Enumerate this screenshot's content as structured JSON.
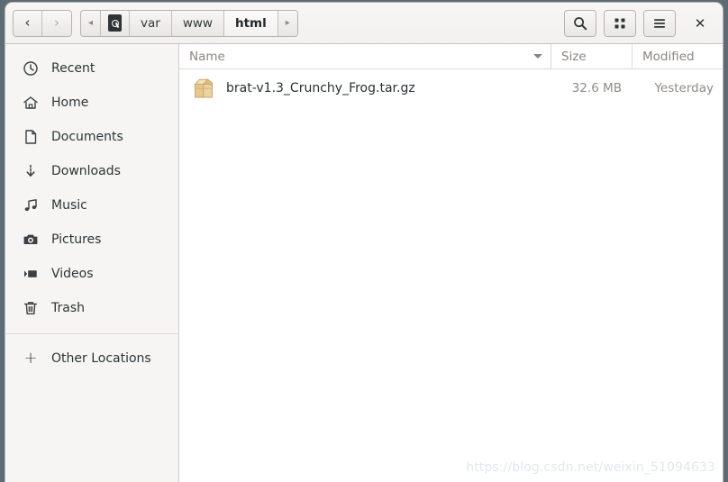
{
  "window": {
    "title": "html"
  },
  "header": {
    "nav": {
      "back_label": "‹",
      "back_name": "back-button",
      "forward_label": "›",
      "forward_name": "forward-button"
    },
    "breadcrumb": {
      "left_scroll": "◂",
      "right_scroll": "▸",
      "items": [
        {
          "label": "",
          "icon": "drive-icon",
          "active": false
        },
        {
          "label": "var",
          "icon": "",
          "active": false
        },
        {
          "label": "www",
          "icon": "",
          "active": false
        },
        {
          "label": "html",
          "icon": "",
          "active": true
        }
      ]
    },
    "actions": [
      {
        "name": "search-button",
        "icon": "search-icon",
        "label": ""
      },
      {
        "name": "view-grid-button",
        "icon": "grid-icon",
        "label": ""
      },
      {
        "name": "menu-button",
        "icon": "hamburger-icon",
        "label": ""
      }
    ],
    "close_label": "✕"
  },
  "sidebar": {
    "items": [
      {
        "label": "Recent",
        "icon": "clock-icon"
      },
      {
        "label": "Home",
        "icon": "home-icon"
      },
      {
        "label": "Documents",
        "icon": "document-icon"
      },
      {
        "label": "Downloads",
        "icon": "download-icon"
      },
      {
        "label": "Music",
        "icon": "music-note-icon"
      },
      {
        "label": "Pictures",
        "icon": "camera-icon"
      },
      {
        "label": "Videos",
        "icon": "video-icon"
      },
      {
        "label": "Trash",
        "icon": "trash-icon"
      }
    ],
    "other_locations": {
      "label": "Other Locations",
      "icon": "plus-icon"
    }
  },
  "filelist": {
    "columns": {
      "name": "Name",
      "size": "Size",
      "modified": "Modified"
    },
    "sort": {
      "column": "Name",
      "direction": "descending"
    },
    "rows": [
      {
        "name": "brat-v1.3_Crunchy_Frog.tar.gz",
        "size": "32.6 MB",
        "modified": "Yesterday",
        "icon": "archive-icon"
      }
    ]
  },
  "watermark": {
    "text": "https://blog.csdn.net/weixin_51094633"
  }
}
